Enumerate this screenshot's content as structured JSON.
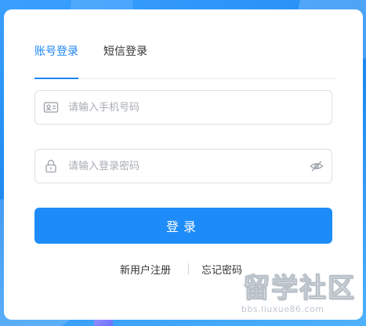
{
  "tabs": [
    {
      "label": "账号登录",
      "active": true
    },
    {
      "label": "短信登录",
      "active": false
    }
  ],
  "phone_field": {
    "placeholder": "请输入手机号码",
    "value": "",
    "icon": "id-card-icon"
  },
  "password_field": {
    "placeholder": "请输入登录密码",
    "value": "",
    "icon": "lock-icon",
    "toggle_icon": "eye-hidden-icon"
  },
  "login_button": {
    "label": "登录"
  },
  "links": {
    "register": "新用户注册",
    "forgot": "忘记密码"
  },
  "watermark": {
    "brand": "留学社区",
    "url": "bbs.liuxue86.com"
  },
  "colors": {
    "accent": "#1d86f5",
    "button": "#1d8cf8",
    "background": "#2a94f8"
  }
}
